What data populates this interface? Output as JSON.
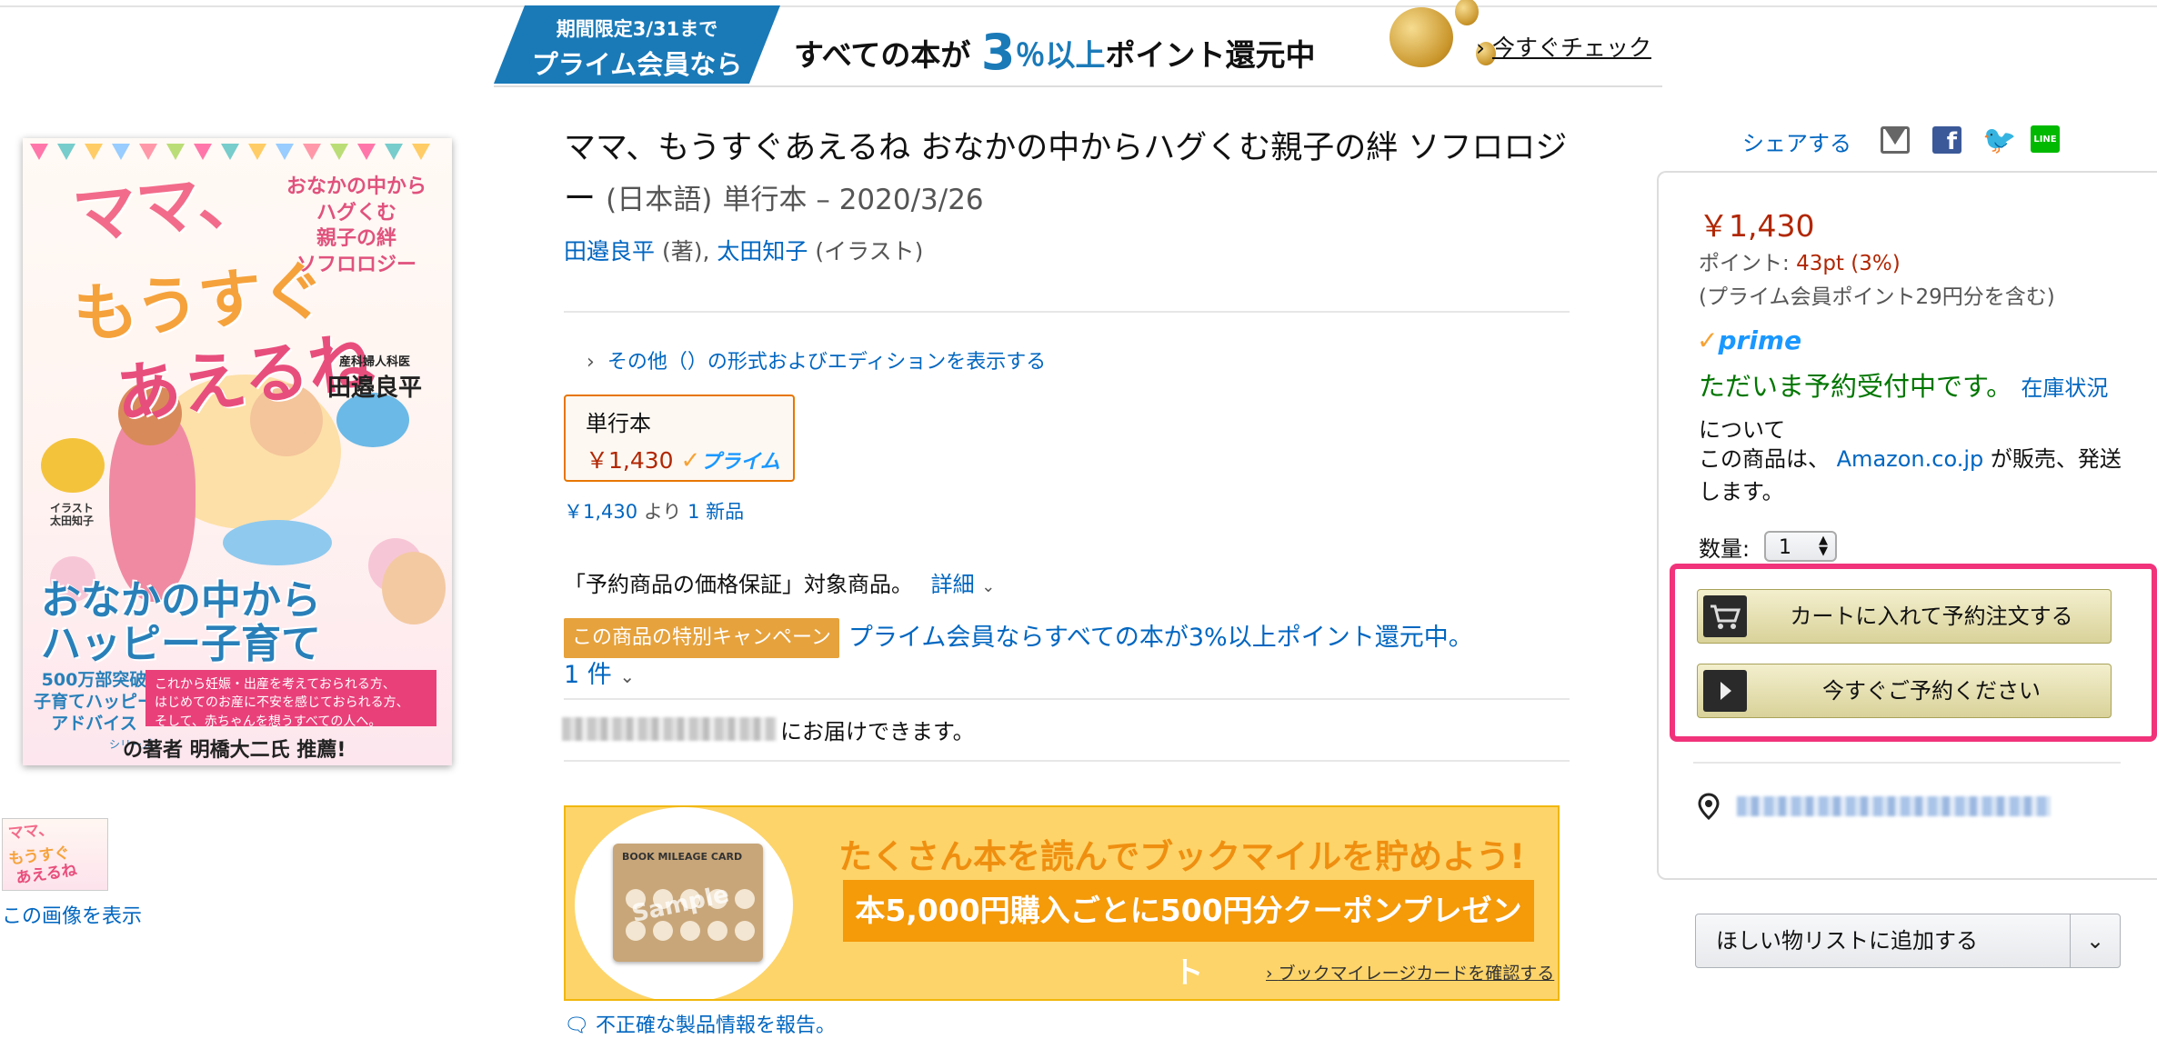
{
  "promo_banner": {
    "badge_line1": "期間限定3/31まで",
    "badge_line2": "プライム会員なら",
    "message_prefix": "すべての本が",
    "message_number": "3",
    "message_percent": "％以上",
    "message_suffix": "ポイント還元中",
    "check_link": "今すぐチェック"
  },
  "cover": {
    "title_line1": "ママ、",
    "title_line2": "もうすぐ",
    "title_line3": "あえるね",
    "subtitle": "おなかの中から\nハグくむ\n親子の絆\nソフロロジー",
    "author_role": "産科婦人科医",
    "author": "田邉良平",
    "illustrator_role": "イラスト",
    "illustrator": "太田知子",
    "band_line1": "おなかの中から",
    "band_line2": "ハッピー子育て",
    "left_block": "500万部突破\n子育てハッピー\nアドバイス",
    "pink_text": "これから妊娠・出産を考えておられる方、\nはじめてのお産に不安を感じておられる方、\nそして、赤ちゃんを想うすべての人へ。",
    "series": "シリーズ",
    "bottom": "の著者 明橋大二氏 推薦!"
  },
  "thumbnail_link": "この画像を表示",
  "product": {
    "title": "ママ、もうすぐあえるね おなかの中からハグくむ親子の絆 ソフロロジー",
    "language": "(日本語)",
    "binding_date": "単行本 – 2020/3/26",
    "author1": "田邉良平",
    "author1_role": "(著),",
    "author2": "太田知子",
    "author2_role": "(イラスト)",
    "other_formats": "その他（）の形式およびエディションを表示する",
    "format_name": "単行本",
    "format_price": "￥1,430",
    "format_prime": "プライム",
    "offers_price": "￥1,430",
    "offers_from": "より",
    "offers_new": "1 新品",
    "guarantee_text": "「予約商品の価格保証」対象商品。",
    "guarantee_details": "詳細",
    "campaign_badge": "この商品の特別キャンペーン",
    "campaign_text": "プライム会員ならすべての本が3%以上ポイント還元中。",
    "campaign_count": "1 件",
    "delivery_text": "にお届けできます。",
    "report_link": "不正確な製品情報を報告。"
  },
  "mileage_banner": {
    "card_title": "BOOK MILEAGE CARD",
    "card_sample": "Sample",
    "headline": "たくさん本を読んでブックマイルを貯めよう!",
    "bar_text": "本5,000円購入ごとに500円分クーポンプレゼント",
    "link": "ブックマイレージカードを確認する"
  },
  "share": {
    "label": "シェアする"
  },
  "buybox": {
    "price": "￥1,430",
    "points_label": "ポイント:",
    "points_value": "43pt (3%)",
    "prime_points_note": "(プライム会員ポイント29円分を含む)",
    "prime_label": "prime",
    "availability": "ただいま予約受付中です。",
    "stock_link": "在庫状況",
    "stock_suffix": "について",
    "seller_prefix": "この商品は、",
    "seller_link": "Amazon.co.jp",
    "seller_suffix": "が販売、発送します。",
    "qty_label": "数量:",
    "qty_value": "1",
    "add_to_cart": "カートに入れて予約注文する",
    "buy_now": "今すぐご予約ください",
    "wishlist": "ほしい物リストに追加する"
  },
  "colors": {
    "link": "#0066c0",
    "price": "#b12704",
    "available": "#007600",
    "prime": "#1a98ff",
    "highlight_border": "#f0337a",
    "banner_blue": "#1a7ab8",
    "mileage_orange": "#f59a09"
  }
}
